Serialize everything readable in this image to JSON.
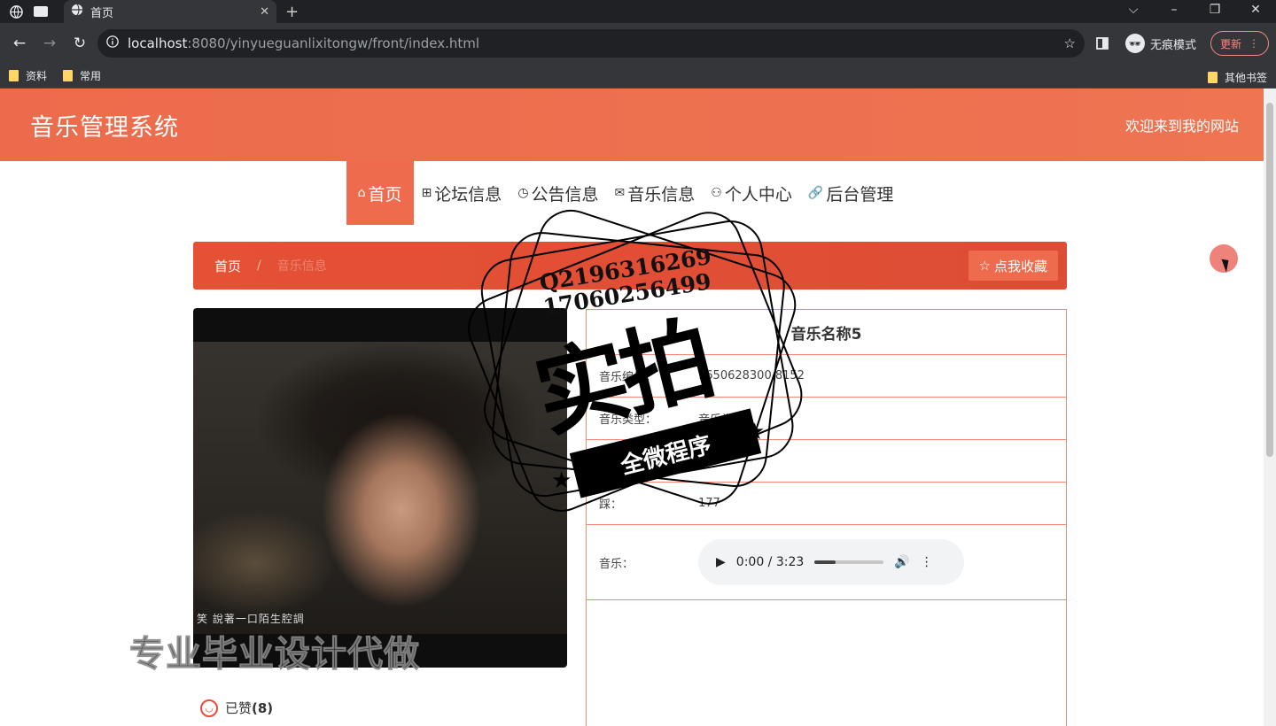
{
  "browser": {
    "tab_title": "首页",
    "url_host": "localhost",
    "url_path": ":8080/yinyueguanlixitongw/front/index.html",
    "incognito_label": "无痕模式",
    "update_label": "更新",
    "bookmarks": [
      "资料",
      "常用"
    ],
    "other_bookmarks": "其他书签"
  },
  "header": {
    "brand": "音乐管理系统",
    "welcome": "欢迎来到我的网站"
  },
  "menu": {
    "items": [
      {
        "icon": "home-icon",
        "label": "首页"
      },
      {
        "icon": "forum-icon",
        "label": "论坛信息"
      },
      {
        "icon": "notice-icon",
        "label": "公告信息"
      },
      {
        "icon": "music-icon",
        "label": "音乐信息"
      },
      {
        "icon": "user-icon",
        "label": "个人中心"
      },
      {
        "icon": "link-icon",
        "label": "后台管理"
      }
    ]
  },
  "breadcrumb": {
    "home": "首页",
    "separator": "/",
    "current": "音乐信息",
    "collect_label": "点我收藏"
  },
  "photo": {
    "subtitle": "笑 說著一口陌生腔調"
  },
  "detail": {
    "title": "音乐名称5",
    "rows": [
      {
        "key": "音乐编号：",
        "value": "1650628300 8152"
      },
      {
        "key": "音乐类型：",
        "value": "音乐类型2"
      },
      {
        "key": "",
        "value": ""
      },
      {
        "key": "踩：",
        "value": "177"
      }
    ],
    "audio_key": "音乐：",
    "audio_time": "0:00 / 3:23",
    "audio_progress": 0.3
  },
  "likes": {
    "label": "已赞",
    "count": "(8)"
  },
  "watermark": {
    "qq": "Q2196316269",
    "phone": "17060256499",
    "big": "实拍",
    "banner": "全微程序",
    "bottom": "专业毕业设计代做"
  },
  "colors": {
    "accent": "#ee6c4d",
    "breadcrumb": "#e55135",
    "border": "#ef8a73"
  }
}
